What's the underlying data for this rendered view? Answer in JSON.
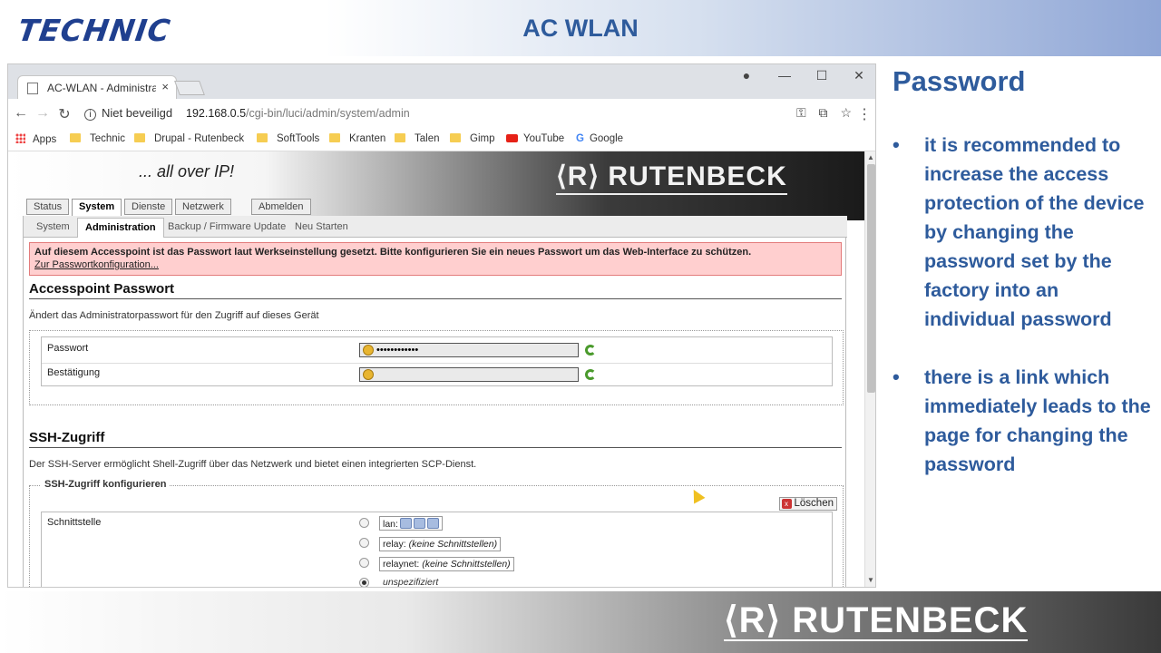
{
  "slide": {
    "brand": "TECHNIC",
    "title": "AC WLAN",
    "footer_logo": "⟨R⟩ RUTENBECK",
    "notes_title": "Password",
    "bullets": [
      "it is recommended to increase the access protection of the device by changing the password set by the factory into an individual password",
      "there is a link which immediately leads to the page for changing the password"
    ]
  },
  "browser": {
    "tab_title": "AC-WLAN - Administratio",
    "tab_close": "×",
    "security_label": "Niet beveiligd",
    "url_host": "192.168.0.5",
    "url_path": "/cgi-bin/luci/admin/system/admin",
    "bookmarks": [
      "Apps",
      "Technic",
      "Drupal - Rutenbeck",
      "SoftTools",
      "Kranten",
      "Talen",
      "Gimp",
      "YouTube",
      "Google"
    ]
  },
  "router": {
    "tagline": "... all over IP!",
    "logo": "⟨R⟩ RUTENBECK",
    "main_tabs": [
      "Status",
      "System",
      "Dienste",
      "Netzwerk",
      "Abmelden"
    ],
    "sub_tabs": [
      "System",
      "Administration",
      "Backup / Firmware Update",
      "Neu Starten"
    ],
    "alert_text": "Auf diesem Accesspoint ist das Passwort laut Werkseinstellung gesetzt. Bitte konfigurieren Sie ein neues Passwort um das Web-Interface zu schützen.",
    "alert_link": "Zur Passwortkonfiguration...",
    "pw_section": {
      "title": "Accesspoint Passwort",
      "desc": "Ändert das Administratorpasswort für den Zugriff auf dieses Gerät",
      "password_label": "Passwort",
      "password_value": "••••••••••••",
      "confirm_label": "Bestätigung"
    },
    "ssh_section": {
      "title": "SSH-Zugriff",
      "desc": "Der SSH-Server ermöglicht Shell-Zugriff über das Netzwerk und bietet einen integrierten SCP-Dienst.",
      "legend": "SSH-Zugriff konfigurieren",
      "delete_label": "Löschen",
      "interface_label": "Schnittstelle",
      "options": {
        "lan": "lan:",
        "relay": "relay:",
        "relaynet": "relaynet:",
        "none_text": "(keine Schnittstellen)",
        "unspecified": "unspezifiziert"
      }
    }
  },
  "colors": {
    "accent_blue": "#2e5b9c",
    "alert_bg": "#ffcfcf",
    "alert_border": "#e37b7b"
  }
}
